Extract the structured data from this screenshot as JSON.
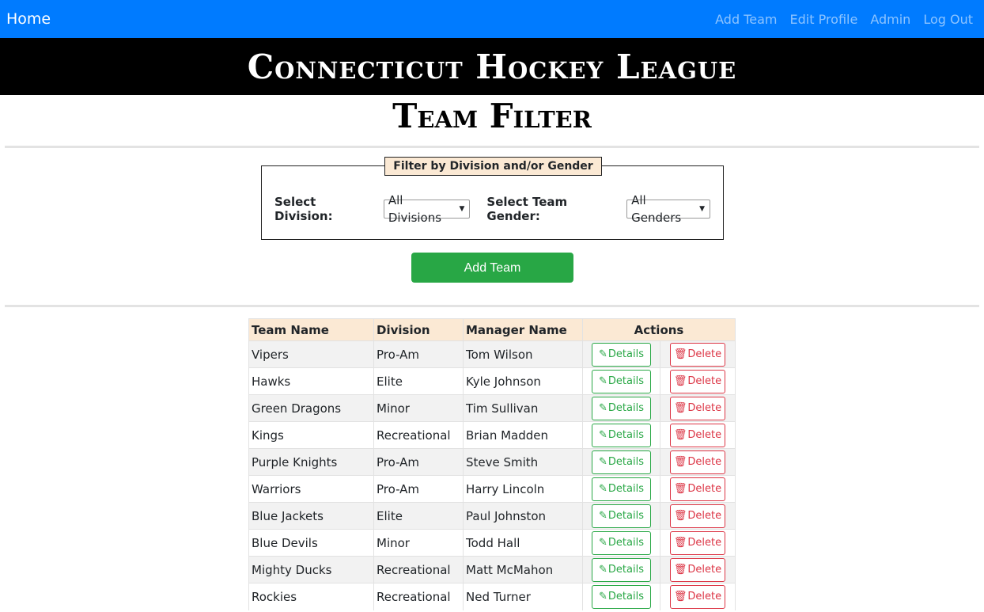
{
  "nav": {
    "brand": "Home",
    "links": [
      "Add Team",
      "Edit Profile",
      "Admin",
      "Log Out"
    ]
  },
  "banner": {
    "title": "Connecticut Hockey League"
  },
  "page": {
    "title": "Team Filter"
  },
  "filter": {
    "legend": "Filter by Division and/or Gender",
    "division_label": "Select Division:",
    "division_value": "All Divisions",
    "gender_label": "Select Team Gender:",
    "gender_value": "All Genders"
  },
  "add_team_button": "Add Team",
  "table": {
    "headers": [
      "Team Name",
      "Division",
      "Manager Name",
      "Actions"
    ],
    "details_label": "Details",
    "delete_label": "Delete",
    "rows": [
      [
        "Vipers",
        "Pro-Am",
        "Tom Wilson"
      ],
      [
        "Hawks",
        "Elite",
        "Kyle Johnson"
      ],
      [
        "Green Dragons",
        "Minor",
        "Tim Sullivan"
      ],
      [
        "Kings",
        "Recreational",
        "Brian Madden"
      ],
      [
        "Purple Knights",
        "Pro-Am",
        "Steve Smith"
      ],
      [
        "Warriors",
        "Pro-Am",
        "Harry Lincoln"
      ],
      [
        "Blue Jackets",
        "Elite",
        "Paul Johnston"
      ],
      [
        "Blue Devils",
        "Minor",
        "Todd Hall"
      ],
      [
        "Mighty Ducks",
        "Recreational",
        "Matt McMahon"
      ],
      [
        "Rockies",
        "Recreational",
        "Ned Turner"
      ]
    ]
  },
  "colors": {
    "navbar": "#007bff",
    "banner": "#000000",
    "accent_header": "#fbe9d4",
    "success": "#28a745",
    "danger": "#dc3545"
  }
}
